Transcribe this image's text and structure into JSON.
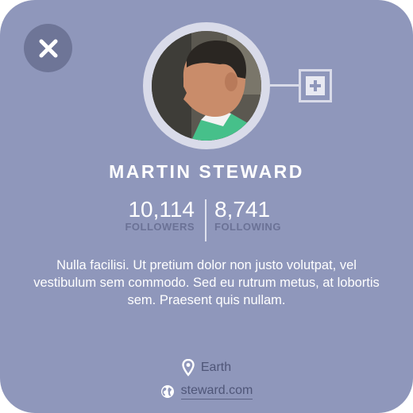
{
  "profile": {
    "name": "MARTIN STEWARD",
    "bio": "Nulla facilisi. Ut pretium dolor non justo volutpat, vel vestibulum sem commodo. Sed eu rutrum metus, at lobortis sem. Praesent quis nullam.",
    "location": "Earth",
    "website": "steward.com"
  },
  "stats": {
    "followers": {
      "value": "10,114",
      "label": "FOLLOWERS"
    },
    "following": {
      "value": "8,741",
      "label": "FOLLOWING"
    }
  },
  "icons": {
    "close": "close-icon",
    "add": "plus-icon",
    "location": "map-pin-icon",
    "website": "globe-icon"
  },
  "colors": {
    "card_background": "#8f97bb",
    "close_button": "#6e7597",
    "ring": "#d9dbe9",
    "muted_text": "#4f5678",
    "stat_label": "#6b7296"
  }
}
